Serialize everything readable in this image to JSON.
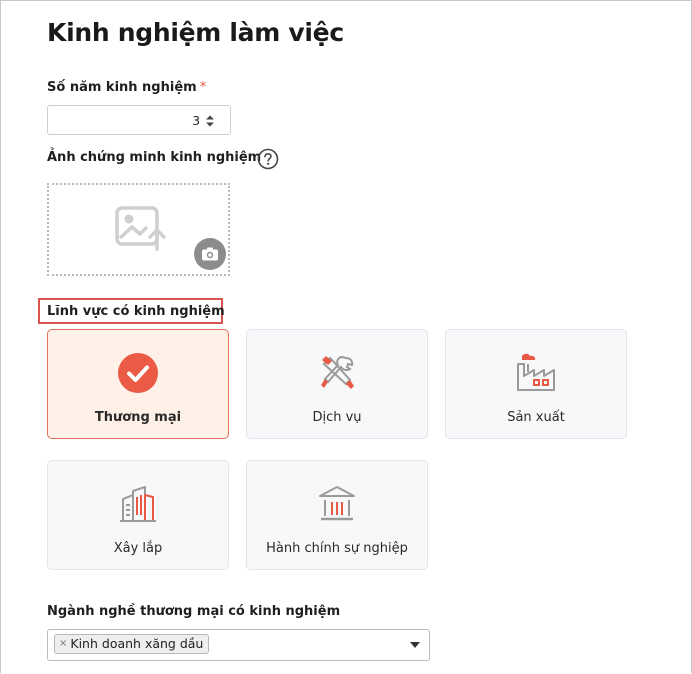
{
  "page": {
    "title": "Kinh nghiệm làm việc"
  },
  "experience_years": {
    "label": "Số năm kinh nghiệm",
    "required_mark": "*",
    "value": "3"
  },
  "proof_image": {
    "label": "Ảnh chứng minh kinh nghiệm"
  },
  "fields": {
    "label": "Lĩnh vực có kinh nghiệm",
    "items": [
      {
        "label": "Thương mại",
        "selected": true,
        "icon": "check-circle-icon"
      },
      {
        "label": "Dịch vụ",
        "selected": false,
        "icon": "tools-icon"
      },
      {
        "label": "Sản xuất",
        "selected": false,
        "icon": "factory-icon"
      },
      {
        "label": "Xây lắp",
        "selected": false,
        "icon": "buildings-icon"
      },
      {
        "label": "Hành chính sự nghiệp",
        "selected": false,
        "icon": "government-building-icon"
      }
    ]
  },
  "industries": {
    "label": "Ngành nghề thương mại có kinh nghiệm",
    "tags": [
      {
        "label": "Kinh doanh xăng dầu",
        "remove": "×"
      }
    ]
  },
  "colors": {
    "accent": "#e5533d",
    "selected_bg": "#fff1e8",
    "card_bg": "#f7f8fa"
  }
}
